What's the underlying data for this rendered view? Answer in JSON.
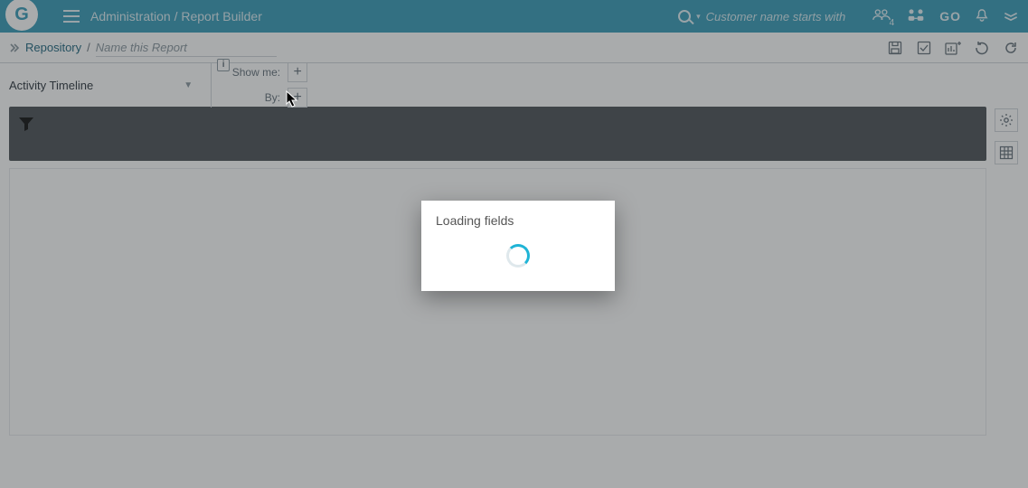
{
  "topbar": {
    "logo_letter": "G",
    "breadcrumb": "Administration / Report Builder",
    "search_placeholder": "Customer name starts with",
    "user_badge_count": "4",
    "go_label": "GO"
  },
  "subheader": {
    "root_label": "Repository",
    "separator": "/",
    "report_name_placeholder": "Name this Report"
  },
  "config": {
    "dropdown_label": "Activity Timeline",
    "show_me_label": "Show me:",
    "by_label": "By:"
  },
  "modal": {
    "title": "Loading fields"
  }
}
